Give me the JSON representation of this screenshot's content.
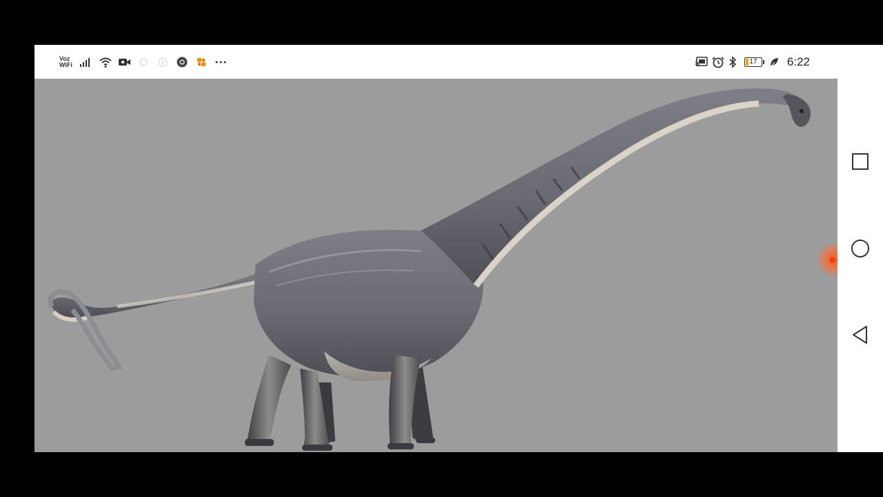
{
  "status_bar": {
    "voz_line1": "Voz",
    "voz_line2": "WiFi",
    "left_icons": [
      "signal-bars-icon",
      "wifi-icon",
      "video-camera-icon",
      "faded-notification-icon",
      "faded-info-icon",
      "chrome-icon",
      "app-notification-icon",
      "more-dots-icon"
    ],
    "right_icons": [
      "cast-icon",
      "alarm-icon",
      "bluetooth-icon",
      "battery-icon",
      "leaf-icon"
    ],
    "battery_level": "17",
    "time": "6:22"
  },
  "content": {
    "image_subject": "dinosaur-illustration-icon",
    "background_color": "#9c9c9c"
  },
  "nav_bar": {
    "buttons": [
      "recents-square-icon",
      "home-circle-icon",
      "back-triangle-icon"
    ]
  },
  "colors": {
    "accent_dot": "#ff3b10",
    "battery_fill": "#f0a800"
  }
}
